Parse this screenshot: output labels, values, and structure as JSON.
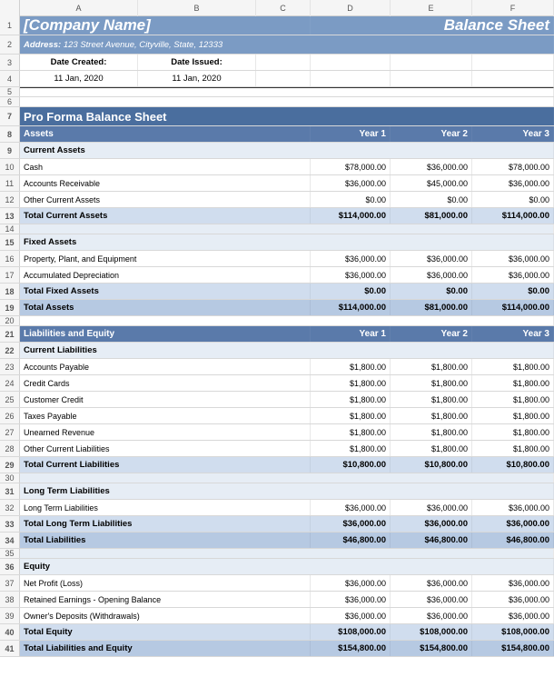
{
  "cols": [
    "A",
    "B",
    "C",
    "D",
    "E",
    "F"
  ],
  "header": {
    "company": "[Company Name]",
    "sheetTitle": "Balance Sheet",
    "addressLabel": "Address:",
    "address": "123 Street Avenue, Cityville, State, 12333",
    "dateCreatedLabel": "Date Created:",
    "dateCreated": "11 Jan, 2020",
    "dateIssuedLabel": "Date Issued:",
    "dateIssued": "11 Jan, 2020"
  },
  "proforma": {
    "title": "Pro Forma Balance Sheet",
    "assetsHeader": "Assets",
    "years": [
      "Year 1",
      "Year 2",
      "Year 3"
    ],
    "currentAssets": {
      "label": "Current Assets",
      "rows": [
        {
          "n": "10",
          "label": "Cash",
          "v": [
            "$78,000.00",
            "$36,000.00",
            "$78,000.00"
          ]
        },
        {
          "n": "11",
          "label": "Accounts Receivable",
          "v": [
            "$36,000.00",
            "$45,000.00",
            "$36,000.00"
          ]
        },
        {
          "n": "12",
          "label": "Other Current Assets",
          "v": [
            "$0.00",
            "$0.00",
            "$0.00"
          ]
        }
      ],
      "total": {
        "n": "13",
        "label": "Total Current Assets",
        "v": [
          "$114,000.00",
          "$81,000.00",
          "$114,000.00"
        ]
      }
    },
    "fixedAssets": {
      "label": "Fixed Assets",
      "rows": [
        {
          "n": "16",
          "label": "Property, Plant, and Equipment",
          "v": [
            "$36,000.00",
            "$36,000.00",
            "$36,000.00"
          ]
        },
        {
          "n": "17",
          "label": "Accumulated Depreciation",
          "v": [
            "$36,000.00",
            "$36,000.00",
            "$36,000.00"
          ]
        }
      ],
      "total": {
        "n": "18",
        "label": "Total Fixed Assets",
        "v": [
          "$0.00",
          "$0.00",
          "$0.00"
        ]
      }
    },
    "totalAssets": {
      "n": "19",
      "label": "Total Assets",
      "v": [
        "$114,000.00",
        "$81,000.00",
        "$114,000.00"
      ]
    },
    "liabHeader": "Liabilities and Equity",
    "currentLiab": {
      "label": "Current Liabilities",
      "rows": [
        {
          "n": "23",
          "label": "Accounts Payable",
          "v": [
            "$1,800.00",
            "$1,800.00",
            "$1,800.00"
          ]
        },
        {
          "n": "24",
          "label": "Credit Cards",
          "v": [
            "$1,800.00",
            "$1,800.00",
            "$1,800.00"
          ]
        },
        {
          "n": "25",
          "label": "Customer Credit",
          "v": [
            "$1,800.00",
            "$1,800.00",
            "$1,800.00"
          ]
        },
        {
          "n": "26",
          "label": "Taxes Payable",
          "v": [
            "$1,800.00",
            "$1,800.00",
            "$1,800.00"
          ]
        },
        {
          "n": "27",
          "label": "Unearned Revenue",
          "v": [
            "$1,800.00",
            "$1,800.00",
            "$1,800.00"
          ]
        },
        {
          "n": "28",
          "label": "Other Current Liabilities",
          "v": [
            "$1,800.00",
            "$1,800.00",
            "$1,800.00"
          ]
        }
      ],
      "total": {
        "n": "29",
        "label": "Total Current Liabilities",
        "v": [
          "$10,800.00",
          "$10,800.00",
          "$10,800.00"
        ]
      }
    },
    "longLiab": {
      "label": "Long Term Liabilities",
      "rows": [
        {
          "n": "32",
          "label": "Long Term Liabilities",
          "v": [
            "$36,000.00",
            "$36,000.00",
            "$36,000.00"
          ]
        }
      ],
      "total": {
        "n": "33",
        "label": "Total Long Term Liabilities",
        "v": [
          "$36,000.00",
          "$36,000.00",
          "$36,000.00"
        ]
      }
    },
    "totalLiab": {
      "n": "34",
      "label": "Total Liabilities",
      "v": [
        "$46,800.00",
        "$46,800.00",
        "$46,800.00"
      ]
    },
    "equity": {
      "label": "Equity",
      "rows": [
        {
          "n": "37",
          "label": "Net Profit (Loss)",
          "v": [
            "$36,000.00",
            "$36,000.00",
            "$36,000.00"
          ]
        },
        {
          "n": "38",
          "label": "Retained Earnings - Opening Balance",
          "v": [
            "$36,000.00",
            "$36,000.00",
            "$36,000.00"
          ]
        },
        {
          "n": "39",
          "label": "Owner's Deposits (Withdrawals)",
          "v": [
            "$36,000.00",
            "$36,000.00",
            "$36,000.00"
          ]
        }
      ],
      "total": {
        "n": "40",
        "label": "Total Equity",
        "v": [
          "$108,000.00",
          "$108,000.00",
          "$108,000.00"
        ]
      }
    },
    "totalLiabEquity": {
      "n": "41",
      "label": "Total Liabilities and Equity",
      "v": [
        "$154,800.00",
        "$154,800.00",
        "$154,800.00"
      ]
    }
  }
}
